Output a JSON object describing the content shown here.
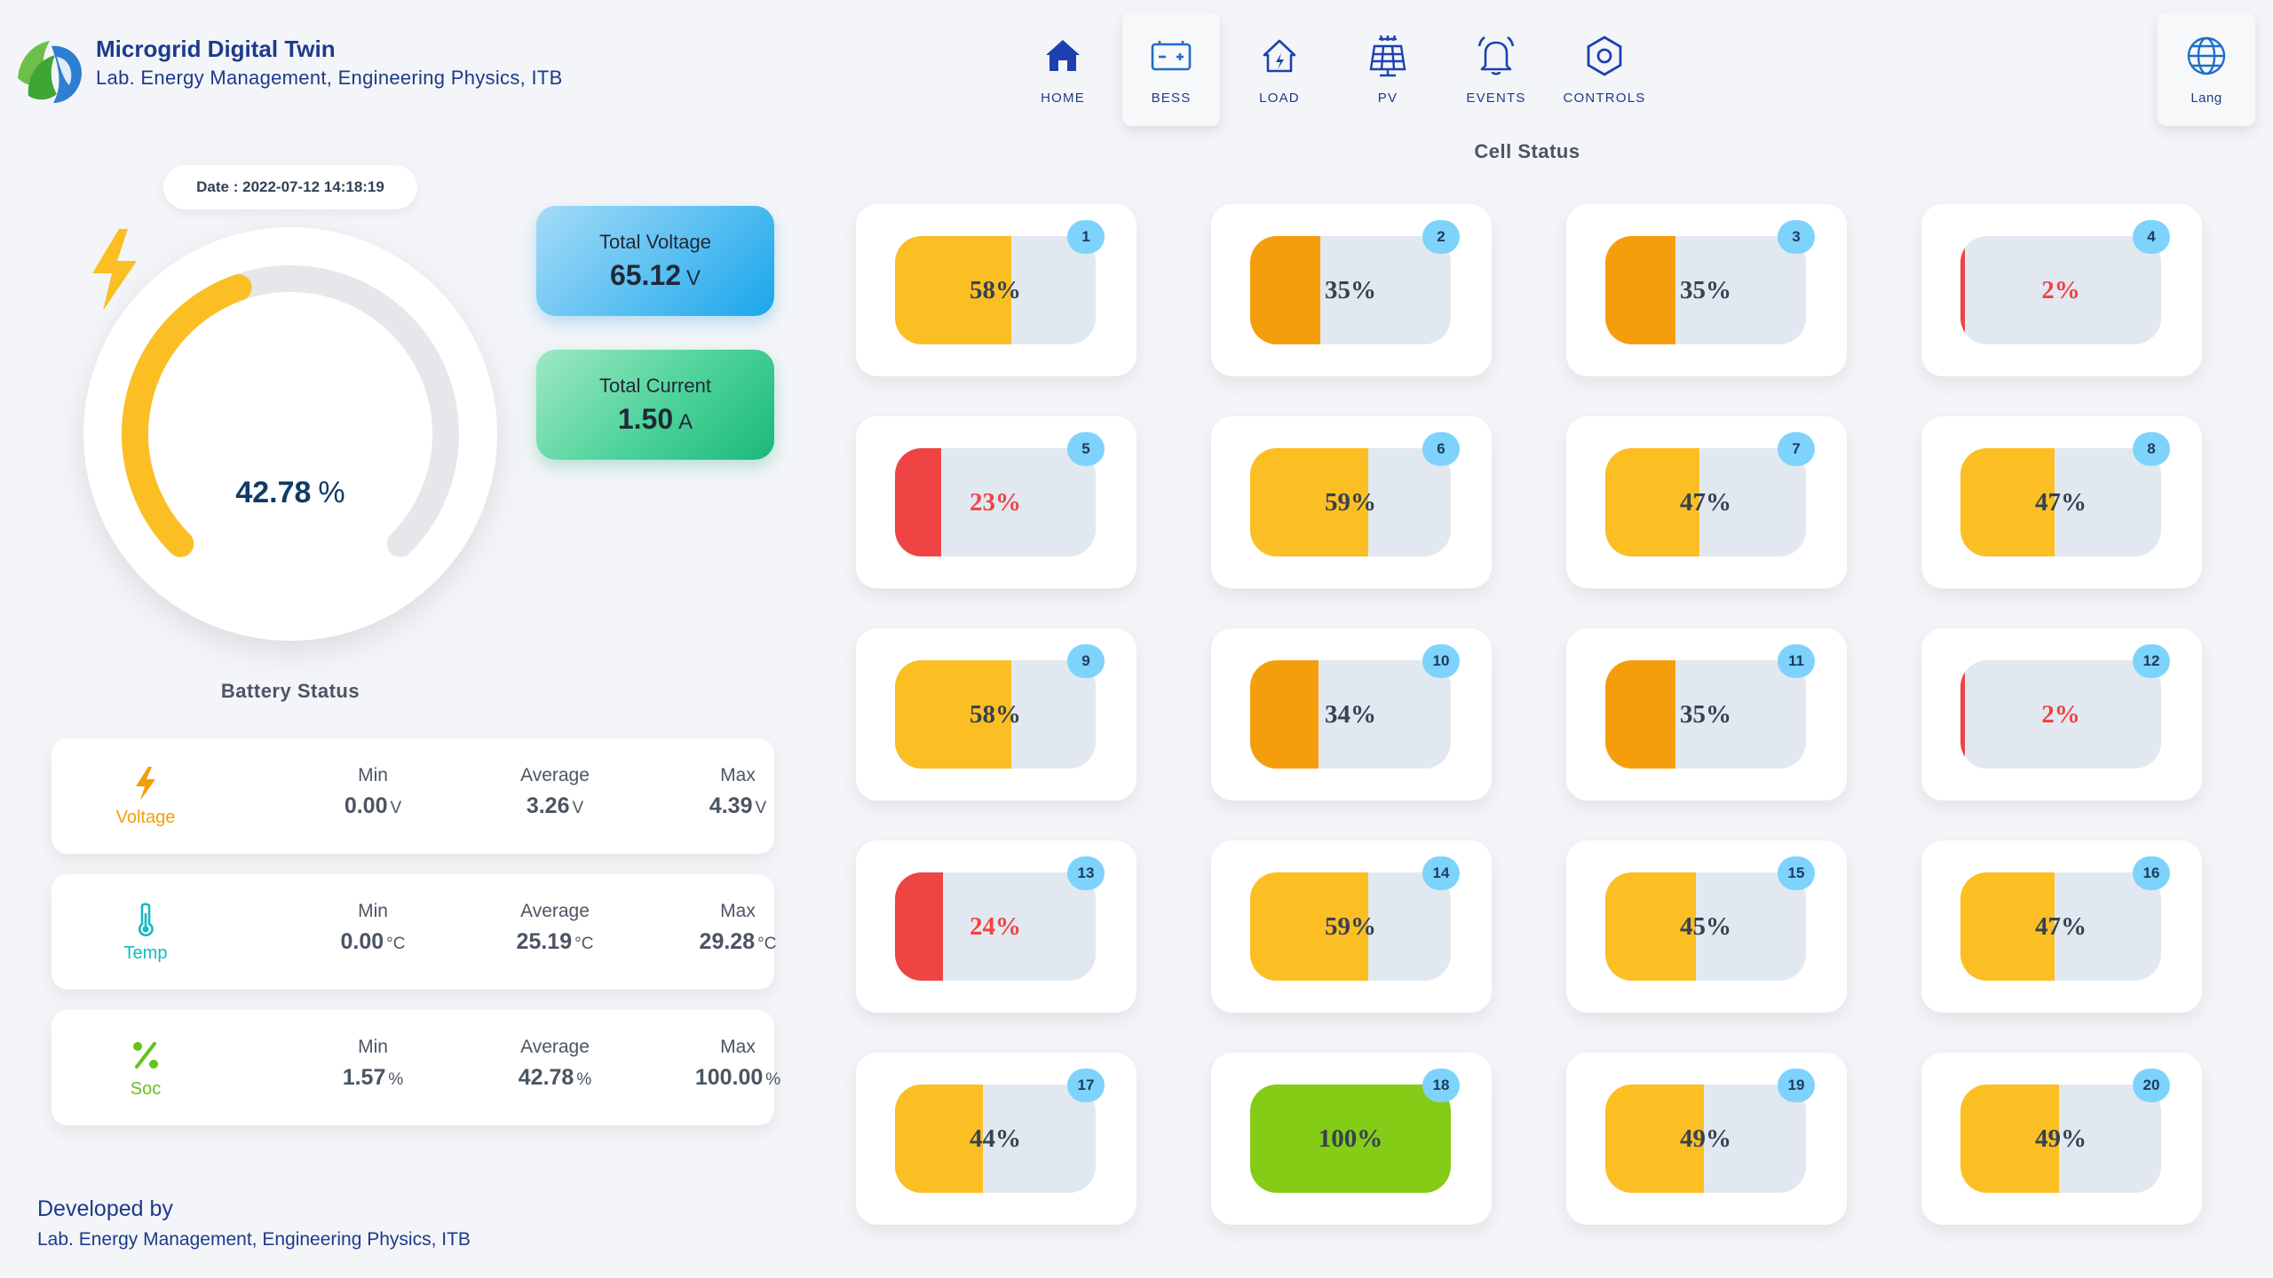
{
  "header": {
    "title": "Microgrid Digital Twin",
    "subtitle": "Lab. Energy Management, Engineering Physics, ITB"
  },
  "nav": {
    "items": [
      {
        "label": "HOME",
        "icon": "home-icon"
      },
      {
        "label": "BESS",
        "icon": "battery-icon",
        "active": true
      },
      {
        "label": "LOAD",
        "icon": "house-load-icon"
      },
      {
        "label": "PV",
        "icon": "solar-panel-icon"
      },
      {
        "label": "EVENTS",
        "icon": "bell-icon"
      },
      {
        "label": "CONTROLS",
        "icon": "hexagon-settings-icon"
      }
    ],
    "lang_label": "Lang"
  },
  "battery": {
    "date_text": "Date : 2022-07-12 14:18:19",
    "soc_value": "42.78",
    "soc_unit": "%",
    "soc_fraction": 0.4278,
    "status_title": "Battery Status",
    "total_voltage": {
      "label": "Total Voltage",
      "value": "65.12",
      "unit": "V"
    },
    "total_current": {
      "label": "Total Current",
      "value": "1.50",
      "unit": "A"
    },
    "headers": {
      "min": "Min",
      "avg": "Average",
      "max": "Max"
    },
    "stats": {
      "voltage": {
        "label": "Voltage",
        "min": "0.00",
        "avg": "3.26",
        "max": "4.39",
        "unit": "V",
        "color": "#f59e0b",
        "icon": "lightning-bolt-icon"
      },
      "temp": {
        "label": "Temp",
        "min": "0.00",
        "avg": "25.19",
        "max": "29.28",
        "unit": "°C",
        "color": "#14b8c4",
        "icon": "thermometer-icon"
      },
      "soc": {
        "label": "Soc",
        "min": "1.57",
        "avg": "42.78",
        "max": "100.00",
        "unit": "%",
        "color": "#65c31b",
        "icon": "percent-icon"
      }
    }
  },
  "cells": {
    "title": "Cell Status",
    "items": [
      {
        "id": "1",
        "pct": 58,
        "text": "58%"
      },
      {
        "id": "2",
        "pct": 35,
        "text": "35%"
      },
      {
        "id": "3",
        "pct": 35,
        "text": "35%"
      },
      {
        "id": "4",
        "pct": 2,
        "text": "2%"
      },
      {
        "id": "5",
        "pct": 23,
        "text": "23%"
      },
      {
        "id": "6",
        "pct": 59,
        "text": "59%"
      },
      {
        "id": "7",
        "pct": 47,
        "text": "47%"
      },
      {
        "id": "8",
        "pct": 47,
        "text": "47%"
      },
      {
        "id": "9",
        "pct": 58,
        "text": "58%"
      },
      {
        "id": "10",
        "pct": 34,
        "text": "34%"
      },
      {
        "id": "11",
        "pct": 35,
        "text": "35%"
      },
      {
        "id": "12",
        "pct": 2,
        "text": "2%"
      },
      {
        "id": "13",
        "pct": 24,
        "text": "24%"
      },
      {
        "id": "14",
        "pct": 59,
        "text": "59%"
      },
      {
        "id": "15",
        "pct": 45,
        "text": "45%"
      },
      {
        "id": "16",
        "pct": 47,
        "text": "47%"
      },
      {
        "id": "17",
        "pct": 44,
        "text": "44%"
      },
      {
        "id": "18",
        "pct": 100,
        "text": "100%"
      },
      {
        "id": "19",
        "pct": 49,
        "text": "49%"
      },
      {
        "id": "20",
        "pct": 49,
        "text": "49%"
      }
    ],
    "colors": {
      "low": "#ef4444",
      "mid": "#f59e0b",
      "normal": "#fbbf24",
      "full": "#84cc16",
      "track": "#e2e8f0"
    }
  },
  "footer": {
    "developed_by": "Developed by",
    "lab": "Lab. Energy Management, Engineering Physics, ITB"
  },
  "colors": {
    "brand": "#1e3a8a",
    "gauge_fill": "#fbbf24",
    "gauge_track": "#e5e7eb"
  }
}
